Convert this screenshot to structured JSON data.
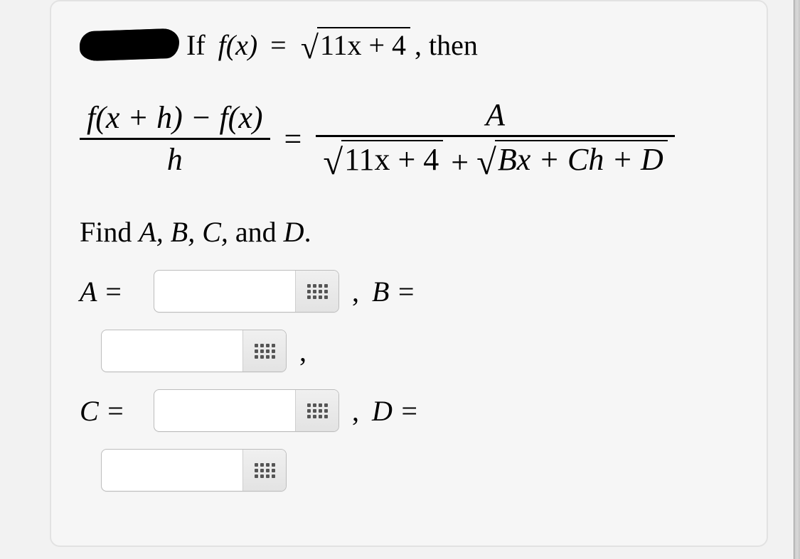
{
  "prompt": {
    "if_text": "If",
    "func_lhs": "f(x)",
    "eq": "=",
    "radicand_main": "11x + 4",
    "then_text": ", then"
  },
  "equation": {
    "lhs_num": "f(x + h) − f(x)",
    "lhs_den": "h",
    "eq": "=",
    "rhs_num": "A",
    "rhs_den_sqrt1": "11x + 4",
    "rhs_den_plus": " + ",
    "rhs_den_sqrt2": "Bx + Ch + D"
  },
  "find_line": {
    "find": "Find ",
    "vars": "A, B, C,",
    "and": " and ",
    "lastvar": "D",
    "period": "."
  },
  "answers": {
    "A_label": "A =",
    "B_label": "B =",
    "C_label": "C =",
    "D_label": "D =",
    "A_value": "",
    "B_value": "",
    "C_value": "",
    "D_value": "",
    "comma": ","
  }
}
